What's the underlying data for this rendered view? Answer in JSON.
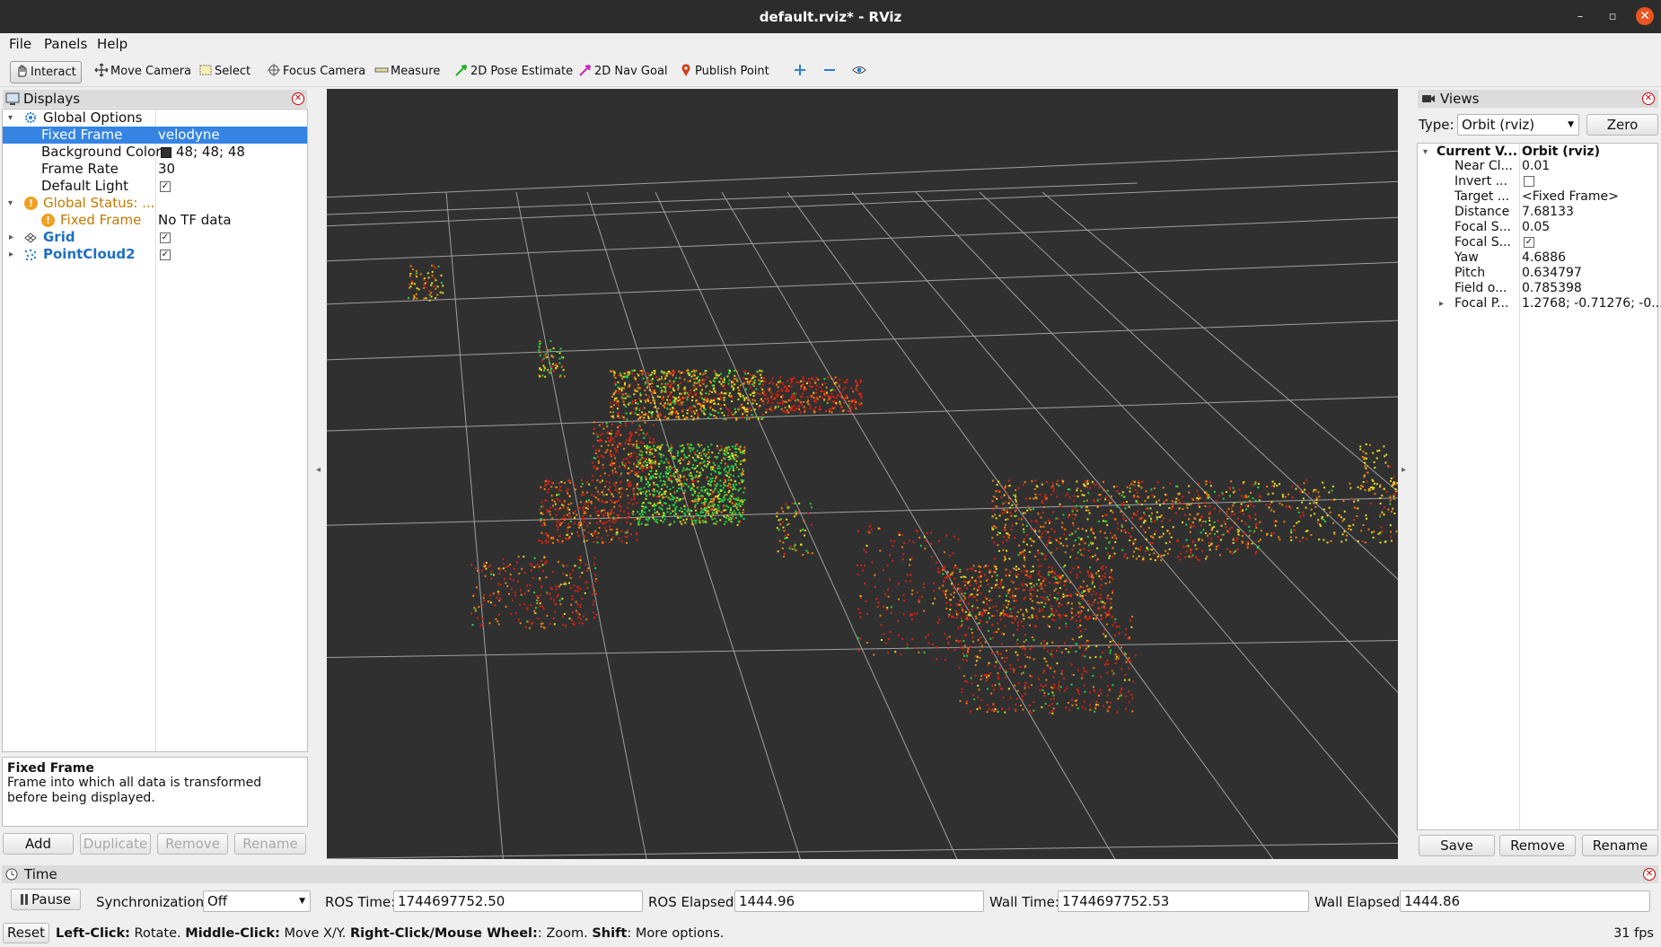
{
  "window": {
    "title": "default.rviz* - RViz",
    "minimize": "–",
    "maximize": "▫",
    "close": "✕"
  },
  "menu": {
    "file": "File",
    "panels": "Panels",
    "help": "Help"
  },
  "toolbar": {
    "interact": "Interact",
    "move_camera": "Move Camera",
    "select": "Select",
    "focus_camera": "Focus Camera",
    "measure": "Measure",
    "pose_estimate": "2D Pose Estimate",
    "nav_goal": "2D Nav Goal",
    "publish_point": "Publish Point",
    "add_tool_icon": "plus-icon",
    "remove_tool_icon": "minus-icon",
    "views_icon": "eye-icon"
  },
  "displays": {
    "title": "Displays",
    "rows": {
      "global_options": "Global Options",
      "fixed_frame_name": "Fixed Frame",
      "fixed_frame_value": "velodyne",
      "bg_color_name": "Background Color",
      "bg_color_value": "48; 48; 48",
      "bg_color_swatch": "#303030",
      "frame_rate_name": "Frame Rate",
      "frame_rate_value": "30",
      "default_light_name": "Default Light",
      "global_status": "Global Status: ...",
      "status_fixed_frame": "Fixed Frame",
      "status_value": "No TF data",
      "grid": "Grid",
      "pointcloud": "PointCloud2"
    },
    "description": {
      "title": "Fixed Frame",
      "text": "Frame into which all data is transformed before being displayed."
    },
    "buttons": {
      "add": "Add",
      "duplicate": "Duplicate",
      "remove": "Remove",
      "rename": "Rename"
    }
  },
  "views": {
    "title": "Views",
    "type_label": "Type:",
    "type_value": "Orbit (rviz)",
    "zero": "Zero",
    "header_name": "Current V...",
    "header_value": "Orbit (rviz)",
    "props": [
      {
        "name": "Near Cl...",
        "value": "0.01"
      },
      {
        "name": "Invert ...",
        "value": ""
      },
      {
        "name": "Target ...",
        "value": "<Fixed Frame>"
      },
      {
        "name": "Distance",
        "value": "7.68133"
      },
      {
        "name": "Focal S...",
        "value": "0.05"
      },
      {
        "name": "Focal S...",
        "value": ""
      },
      {
        "name": "Yaw",
        "value": "4.6886"
      },
      {
        "name": "Pitch",
        "value": "0.634797"
      },
      {
        "name": "Field o...",
        "value": "0.785398"
      },
      {
        "name": "Focal P...",
        "value": "1.2768; -0.71276; -0...."
      }
    ],
    "buttons": {
      "save": "Save",
      "remove": "Remove",
      "rename": "Rename"
    }
  },
  "time": {
    "title": "Time",
    "pause": "Pause",
    "sync_label": "Synchronization:",
    "sync_value": "Off",
    "ros_time_label": "ROS Time:",
    "ros_time": "1744697752.50",
    "ros_elapsed_label": "ROS Elapsed:",
    "ros_elapsed": "1444.96",
    "wall_time_label": "Wall Time:",
    "wall_time": "1744697752.53",
    "wall_elapsed_label": "Wall Elapsed:",
    "wall_elapsed": "1444.86"
  },
  "status": {
    "reset": "Reset",
    "left_click": "Left-Click:",
    "left_desc": " Rotate. ",
    "middle_click": "Middle-Click:",
    "middle_desc": " Move X/Y. ",
    "right_click": "Right-Click/Mouse Wheel:",
    "right_desc": ": Zoom. ",
    "shift": "Shift",
    "shift_desc": ": More options.",
    "fps": "31 fps"
  },
  "colors": {
    "accent": "#3584e4",
    "viewport_bg": "#303030",
    "grid_line": "#a0a0a0",
    "point_red": "#e02010",
    "point_orange": "#f08010",
    "point_yellow": "#e8e020",
    "point_green": "#20d840"
  }
}
